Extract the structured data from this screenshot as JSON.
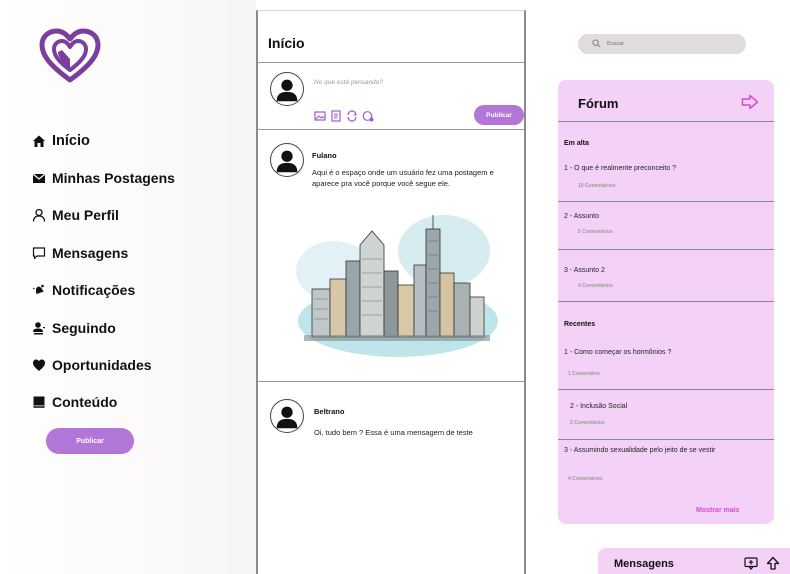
{
  "sidebar": {
    "logo_icon": "heart-logo-icon",
    "items": [
      {
        "label": "Início",
        "icon": "home-icon"
      },
      {
        "label": "Minhas Postagens",
        "icon": "envelope-icon"
      },
      {
        "label": "Meu Perfil",
        "icon": "user-icon"
      },
      {
        "label": "Mensagens",
        "icon": "chat-icon"
      },
      {
        "label": "Notificações",
        "icon": "bell-icon"
      },
      {
        "label": "Seguindo",
        "icon": "users-icon"
      },
      {
        "label": "Oportunidades",
        "icon": "heart-icon"
      },
      {
        "label": "Conteúdo",
        "icon": "book-icon"
      }
    ],
    "publish_label": "Publicar"
  },
  "feed": {
    "title": "Início",
    "composer": {
      "placeholder": "No que está pensando?",
      "publish_label": "Publicar"
    },
    "posts": [
      {
        "author": "Fulano",
        "text": "Aqui é o espaço onde um usuário fez uma postagem e aparece pra você porque você segue ele.",
        "image": "city-sketch-illustration"
      },
      {
        "author": "Beltrano",
        "text": "Oi, tudo bem ? Essa é uma mensagem de teste"
      }
    ]
  },
  "search": {
    "placeholder": "Buscar"
  },
  "forum": {
    "title": "Fórum",
    "trending_label": "Em alta",
    "trending": [
      {
        "title": "1 - O que é realmente preconceito ?",
        "comments": "10 Comentários"
      },
      {
        "title": "2 - Assunto",
        "comments": "5 Comentários"
      },
      {
        "title": "3 - Assunto 2",
        "comments": "4 Comentários"
      }
    ],
    "recent_label": "Recentes",
    "recent": [
      {
        "title": "1 - Como começar os hormônios ?",
        "comments": "1 Comentário"
      },
      {
        "title": "2 - Inclusão Social",
        "comments": "2 Comentários"
      },
      {
        "title": "3 - Assumindo sexualidade pelo jeito de se vestir",
        "comments": "4 Comentários"
      }
    ],
    "more_label": "Mostrar mais"
  },
  "messages_bar": {
    "title": "Mensagens"
  },
  "colors": {
    "accent": "#b275d8",
    "forum_bg": "#f4d2f8",
    "link_pink": "#d64ad8",
    "logo": "#7a3e9c"
  }
}
